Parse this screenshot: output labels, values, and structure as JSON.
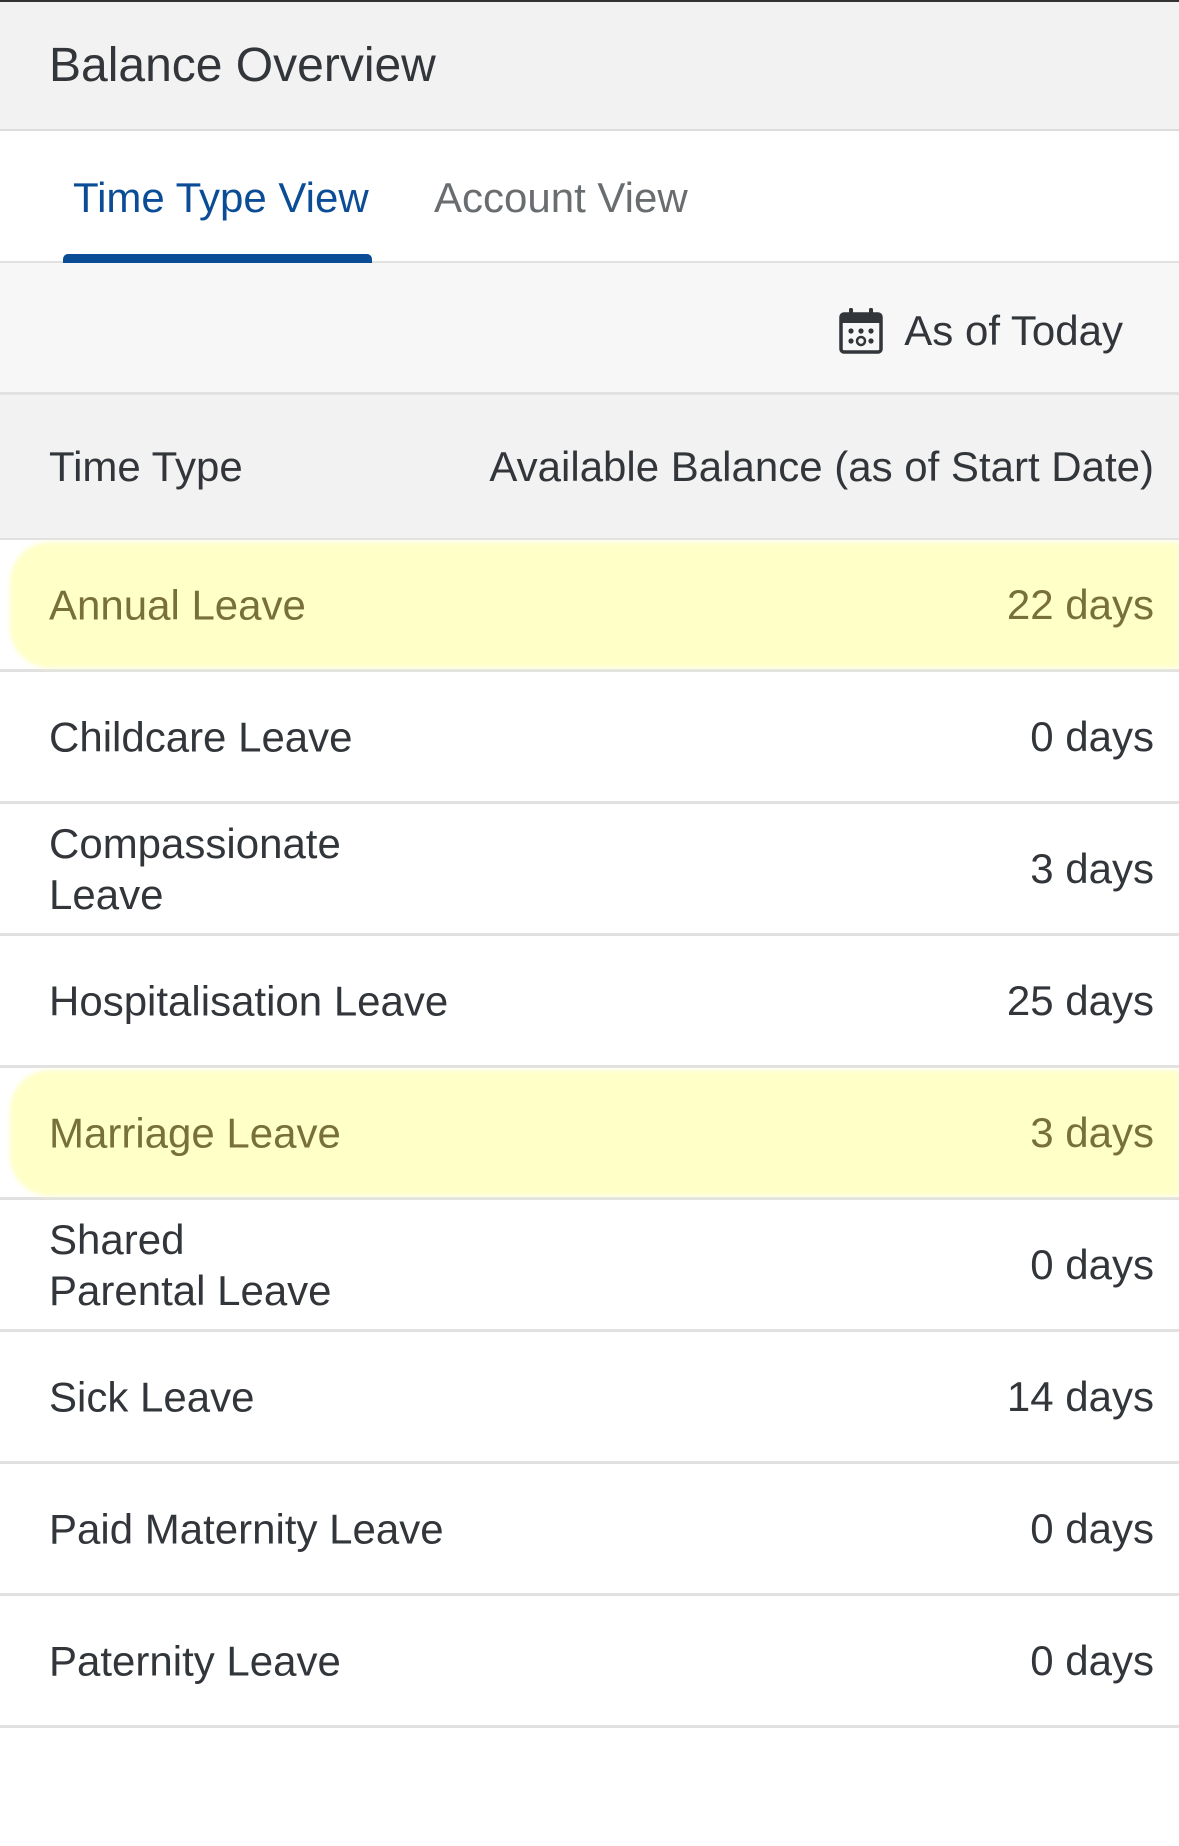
{
  "header": {
    "title": "Balance Overview"
  },
  "tabs": [
    {
      "label": "Time Type View",
      "selected": true
    },
    {
      "label": "Account View",
      "selected": false
    }
  ],
  "date_filter": {
    "label": "As of Today",
    "icon": "calendar-icon"
  },
  "table": {
    "columns": [
      "Time Type",
      "Available Balance (as of Start Date)"
    ],
    "rows": [
      {
        "name": "Annual Leave",
        "balance": "22 days",
        "highlighted": true
      },
      {
        "name": "Childcare Leave",
        "balance": "0 days",
        "highlighted": false
      },
      {
        "name": "Compassionate Leave",
        "balance": "3 days",
        "highlighted": false
      },
      {
        "name": "Hospitalisation Leave",
        "balance": "25 days",
        "highlighted": false
      },
      {
        "name": "Marriage Leave",
        "balance": "3 days",
        "highlighted": true
      },
      {
        "name": "Shared Parental Leave",
        "balance": "0 days",
        "highlighted": false
      },
      {
        "name": "Sick Leave",
        "balance": "14 days",
        "highlighted": false
      },
      {
        "name": "Paid Maternity Leave",
        "balance": "0 days",
        "highlighted": false
      },
      {
        "name": "Paternity Leave",
        "balance": "0 days",
        "highlighted": false
      }
    ]
  },
  "colors": {
    "accent": "#0a4c95",
    "highlight": "#ffffc8",
    "highlight_text": "#77703a"
  }
}
